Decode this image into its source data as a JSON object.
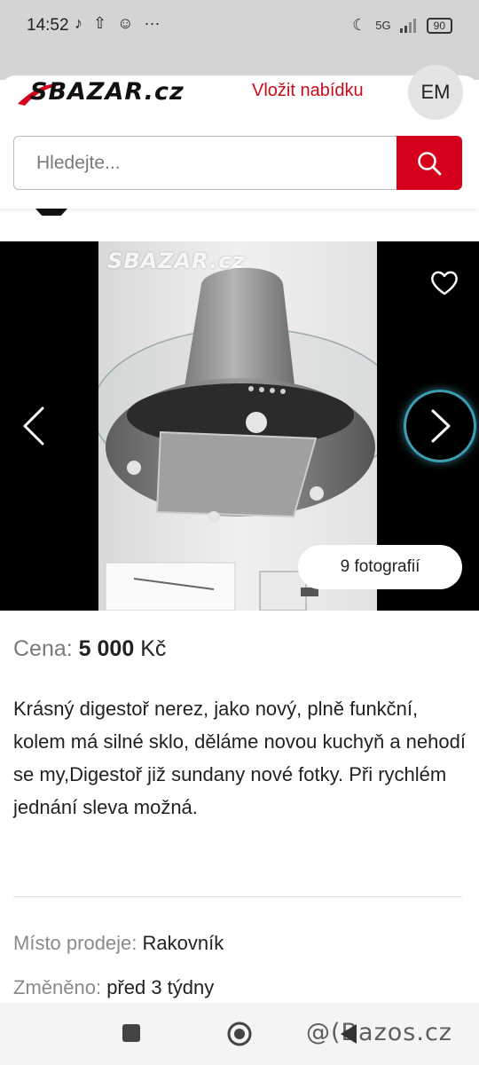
{
  "status": {
    "time": "14:52",
    "network": "5G",
    "battery": "90"
  },
  "header": {
    "logo_text": "SBAZAR.cz",
    "post_link": "Vložit nabídku",
    "avatar_initials": "EM"
  },
  "search": {
    "placeholder": "Hledejte..."
  },
  "gallery": {
    "watermark": "SBAZAR.cz",
    "photo_count": "9 fotografií"
  },
  "listing": {
    "price_label": "Cena:",
    "price_value": "5 000",
    "price_currency": "Kč",
    "description": "Krásný digestoř nerez, jako nový, plně funkční, kolem má silné sklo, děláme novou kuchyň a nehodí se my,Digestoř již sundany nové fotky. Při rychlém jednání sleva možná.",
    "location_label": "Místo prodeje:",
    "location_value": "Rakovník",
    "changed_label": "Změněno:",
    "changed_value": "před 3 týdny"
  },
  "watermark_credit": "@(Bazos.cz",
  "colors": {
    "brand_red": "#d6001c",
    "link_red": "#cc0b1a",
    "next_glow": "#3d9cb0"
  },
  "icons": {
    "search": "search-icon",
    "favorite": "heart-icon",
    "prev": "chevron-left-icon",
    "next": "chevron-right-icon"
  }
}
